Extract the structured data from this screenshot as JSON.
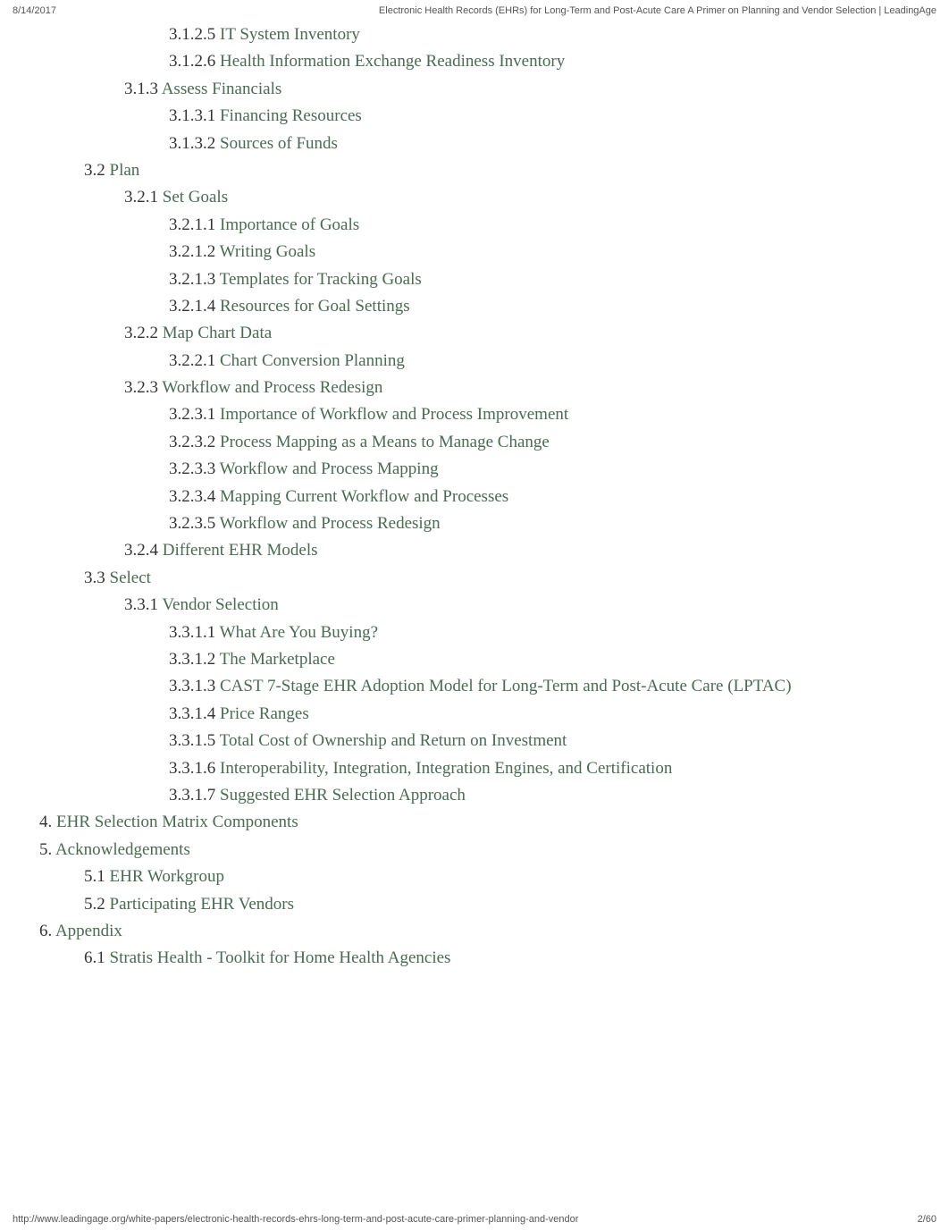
{
  "header": {
    "date": "8/14/2017",
    "title": "Electronic Health Records (EHRs) for Long-Term and Post-Acute Care A Primer on Planning and Vendor Selection | LeadingAge"
  },
  "footer": {
    "url": "http://www.leadingage.org/white-papers/electronic-health-records-ehrs-long-term-and-post-acute-care-primer-planning-and-vendor",
    "page": "2/60"
  },
  "toc": [
    {
      "lv": 4,
      "num": "3.1.2.5",
      "label": "IT System Inventory"
    },
    {
      "lv": 4,
      "num": "3.1.2.6",
      "label": "Health Information Exchange Readiness Inventory"
    },
    {
      "lv": 3,
      "num": "3.1.3",
      "label": "Assess Financials"
    },
    {
      "lv": 4,
      "num": "3.1.3.1",
      "label": "Financing Resources"
    },
    {
      "lv": 4,
      "num": "3.1.3.2",
      "label": "Sources of Funds"
    },
    {
      "lv": 2,
      "num": "3.2",
      "label": "Plan"
    },
    {
      "lv": 3,
      "num": "3.2.1",
      "label": "Set Goals"
    },
    {
      "lv": 4,
      "num": "3.2.1.1",
      "label": "Importance of Goals"
    },
    {
      "lv": 4,
      "num": "3.2.1.2",
      "label": "Writing Goals"
    },
    {
      "lv": 4,
      "num": "3.2.1.3",
      "label": "Templates for Tracking Goals"
    },
    {
      "lv": 4,
      "num": "3.2.1.4",
      "label": "Resources for Goal Settings"
    },
    {
      "lv": 3,
      "num": "3.2.2",
      "label": "Map Chart Data"
    },
    {
      "lv": 4,
      "num": "3.2.2.1",
      "label": "Chart Conversion Planning"
    },
    {
      "lv": 3,
      "num": "3.2.3",
      "label": "Workflow and Process Redesign"
    },
    {
      "lv": 4,
      "num": "3.2.3.1",
      "label": "Importance of Workflow and Process Improvement"
    },
    {
      "lv": 4,
      "num": "3.2.3.2",
      "label": "Process Mapping as a Means to Manage Change"
    },
    {
      "lv": 4,
      "num": "3.2.3.3",
      "label": "Workflow and Process Mapping"
    },
    {
      "lv": 4,
      "num": "3.2.3.4",
      "label": "Mapping Current Workflow and Processes"
    },
    {
      "lv": 4,
      "num": "3.2.3.5",
      "label": "Workflow and Process Redesign"
    },
    {
      "lv": 3,
      "num": "3.2.4",
      "label": "Different EHR Models"
    },
    {
      "lv": 2,
      "num": "3.3",
      "label": "Select"
    },
    {
      "lv": 3,
      "num": "3.3.1",
      "label": "Vendor Selection"
    },
    {
      "lv": 4,
      "num": "3.3.1.1",
      "label": "What Are You Buying?"
    },
    {
      "lv": 4,
      "num": "3.3.1.2",
      "label": "The Marketplace"
    },
    {
      "lv": 4,
      "num": "3.3.1.3",
      "label": "CAST 7-Stage EHR Adoption Model for Long-Term and Post-Acute Care (LPTAC)"
    },
    {
      "lv": 4,
      "num": "3.3.1.4",
      "label": "Price Ranges"
    },
    {
      "lv": 4,
      "num": "3.3.1.5",
      "label": "Total Cost of Ownership and Return on Investment"
    },
    {
      "lv": 4,
      "num": "3.3.1.6",
      "label": "Interoperability, Integration, Integration Engines, and Certification"
    },
    {
      "lv": 4,
      "num": "3.3.1.7",
      "label": "Suggested EHR Selection Approach"
    },
    {
      "lv": 1,
      "num": "4.",
      "label": "EHR Selection Matrix Components"
    },
    {
      "lv": 1,
      "num": "5.",
      "label": "Acknowledgements"
    },
    {
      "lv": 2,
      "num": "5.1",
      "label": "EHR Workgroup"
    },
    {
      "lv": 2,
      "num": "5.2",
      "label": "Participating EHR Vendors"
    },
    {
      "lv": 1,
      "num": "6.",
      "label": "Appendix"
    },
    {
      "lv": 2,
      "num": "6.1",
      "label": "Stratis Health - Toolkit for Home Health Agencies"
    }
  ]
}
